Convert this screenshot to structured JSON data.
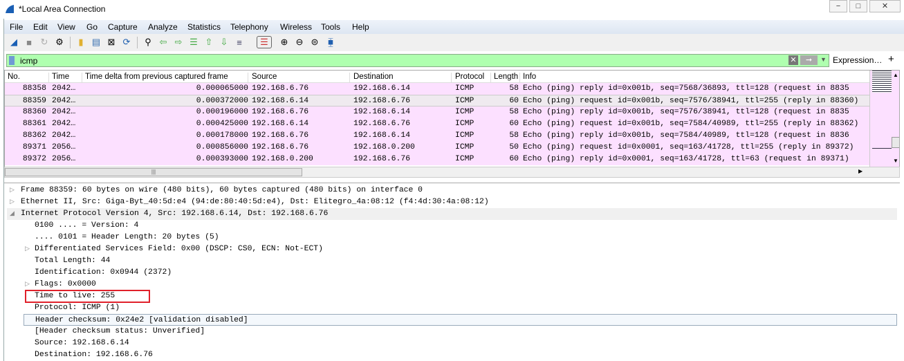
{
  "window": {
    "title": "*Local Area Connection",
    "minimize": "−",
    "maximize": "□",
    "close": "✕"
  },
  "menu": [
    "File",
    "Edit",
    "View",
    "Go",
    "Capture",
    "Analyze",
    "Statistics",
    "Telephony",
    "Wireless",
    "Tools",
    "Help"
  ],
  "filter": {
    "value": "icmp",
    "expression_label": "Expression…",
    "add_label": "+"
  },
  "columns": [
    "No.",
    "Time",
    "Time delta from previous captured frame",
    "Source",
    "Destination",
    "Protocol",
    "Length",
    "Info"
  ],
  "packets": [
    {
      "no": "88358",
      "time": "2042…",
      "delta": "0.000065000",
      "src": "192.168.6.76",
      "dst": "192.168.6.14",
      "proto": "ICMP",
      "len": "58",
      "info": "Echo (ping) reply    id=0x001b, seq=7568/36893, ttl=128 (request in 8835"
    },
    {
      "no": "88359",
      "time": "2042…",
      "delta": "0.000372000",
      "src": "192.168.6.14",
      "dst": "192.168.6.76",
      "proto": "ICMP",
      "len": "60",
      "info": "Echo (ping) request  id=0x001b, seq=7576/38941, ttl=255 (reply in 88360)"
    },
    {
      "no": "88360",
      "time": "2042…",
      "delta": "0.000196000",
      "src": "192.168.6.76",
      "dst": "192.168.6.14",
      "proto": "ICMP",
      "len": "58",
      "info": "Echo (ping) reply    id=0x001b, seq=7576/38941, ttl=128 (request in 8835"
    },
    {
      "no": "88361",
      "time": "2042…",
      "delta": "0.000425000",
      "src": "192.168.6.14",
      "dst": "192.168.6.76",
      "proto": "ICMP",
      "len": "60",
      "info": "Echo (ping) request  id=0x001b, seq=7584/40989, ttl=255 (reply in 88362)"
    },
    {
      "no": "88362",
      "time": "2042…",
      "delta": "0.000178000",
      "src": "192.168.6.76",
      "dst": "192.168.6.14",
      "proto": "ICMP",
      "len": "58",
      "info": "Echo (ping) reply    id=0x001b, seq=7584/40989, ttl=128 (request in 8836"
    },
    {
      "no": "89371",
      "time": "2056…",
      "delta": "0.000856000",
      "src": "192.168.6.76",
      "dst": "192.168.0.200",
      "proto": "ICMP",
      "len": "50",
      "info": "Echo (ping) request  id=0x0001, seq=163/41728, ttl=255 (reply in 89372)"
    },
    {
      "no": "89372",
      "time": "2056…",
      "delta": "0.000393000",
      "src": "192.168.0.200",
      "dst": "192.168.6.76",
      "proto": "ICMP",
      "len": "60",
      "info": "Echo (ping) reply    id=0x0001, seq=163/41728, ttl=63 (request in 89371)"
    }
  ],
  "details": [
    {
      "text": "Frame 88359: 60 bytes on wire (480 bits), 60 bytes captured (480 bits) on interface 0",
      "level": 0,
      "expander": "collapsed"
    },
    {
      "text": "Ethernet II, Src: Giga-Byt_40:5d:e4 (94:de:80:40:5d:e4), Dst: Elitegro_4a:08:12 (f4:4d:30:4a:08:12)",
      "level": 0,
      "expander": "collapsed"
    },
    {
      "text": "Internet Protocol Version 4, Src: 192.168.6.14, Dst: 192.168.6.76",
      "level": 0,
      "expander": "expanded"
    },
    {
      "text": "0100 .... = Version: 4",
      "level": 1
    },
    {
      "text": ".... 0101 = Header Length: 20 bytes (5)",
      "level": 1
    },
    {
      "text": "Differentiated Services Field: 0x00 (DSCP: CS0, ECN: Not-ECT)",
      "level": 1,
      "expander": "collapsed"
    },
    {
      "text": "Total Length: 44",
      "level": 1
    },
    {
      "text": "Identification: 0x0944 (2372)",
      "level": 1
    },
    {
      "text": "Flags: 0x0000",
      "level": 1,
      "expander": "collapsed"
    },
    {
      "text": "Time to live: 255",
      "level": 1,
      "highlight": true
    },
    {
      "text": "Protocol: ICMP (1)",
      "level": 1
    },
    {
      "text": "Header checksum: 0x24e2 [validation disabled]",
      "level": 1,
      "focused": true
    },
    {
      "text": "[Header checksum status: Unverified]",
      "level": 1
    },
    {
      "text": "Source: 192.168.6.14",
      "level": 1
    },
    {
      "text": "Destination: 192.168.6.76",
      "level": 1
    }
  ],
  "colors": {
    "row_bg": "#fce0ff",
    "filter_bg": "#afffaf",
    "highlight_box": "#e0202a"
  }
}
